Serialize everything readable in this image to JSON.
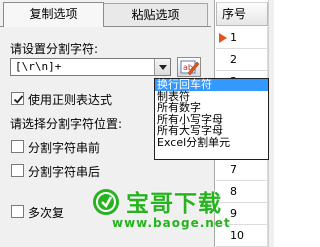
{
  "tabs": [
    {
      "label": "复制选项",
      "active": true
    },
    {
      "label": "粘贴选项",
      "active": false
    }
  ],
  "separator": {
    "prompt": "请设置分割字符:",
    "value": "[\\r\\n]+",
    "use_regex_label": "使用正则表达式",
    "use_regex_checked": true
  },
  "position": {
    "prompt": "请选择分割字符位置:",
    "before_label": "分割字符串前",
    "after_label": "分割字符串后",
    "multi_label": "多次复"
  },
  "dropdown": {
    "items": [
      {
        "label": "换行回车符",
        "selected": true
      },
      {
        "label": "制表符",
        "selected": false
      },
      {
        "label": "所有数字",
        "selected": false
      },
      {
        "label": "所有小写字母",
        "selected": false
      },
      {
        "label": "所有大写字母",
        "selected": false
      },
      {
        "label": "Excel分割单元",
        "selected": false
      }
    ]
  },
  "grid": {
    "header": "序号",
    "rows": [
      "1",
      "2",
      "3",
      "4",
      "5",
      "6",
      "7",
      "8",
      "9",
      "10"
    ],
    "current_row": "1"
  },
  "watermark": {
    "title": "宝哥下载",
    "url": "www.baoge.net"
  },
  "colors": {
    "selection": "#3399ff",
    "row_pointer": "#e0561c",
    "watermark": "#27b31f",
    "panel_bg": "#f0f0f0"
  }
}
